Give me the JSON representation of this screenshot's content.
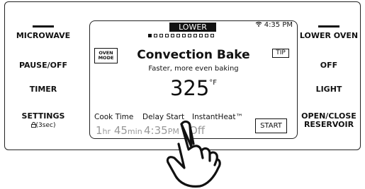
{
  "left_buttons": {
    "microwave": "MICROWAVE",
    "pause_off": "PAUSE/OFF",
    "timer": "TIMER",
    "settings": "SETTINGS",
    "settings_sub": "­(3sec)"
  },
  "right_buttons": {
    "lower_oven": "LOWER OVEN",
    "off": "OFF",
    "light": "LIGHT",
    "open_close_reservoir_line1": "OPEN/CLOSE",
    "open_close_reservoir_line2": "RESERVOIR"
  },
  "screen": {
    "tab_label": "LOWER",
    "clock": "4:35 PM",
    "page_dots": {
      "total": 12,
      "active": 1
    },
    "oven_mode_line1": "OVEN",
    "oven_mode_line2": "MODE",
    "tip_label": "TIP",
    "mode_title": "Convection Bake",
    "mode_subtitle": "Faster, more even baking",
    "temperature": "325",
    "temperature_unit": "°F",
    "cook_time_label": "Cook Time",
    "cook_time_hr": "1",
    "cook_time_hr_unit": "hr",
    "cook_time_min": "45",
    "cook_time_min_unit": "min",
    "delay_start_label": "Delay Start",
    "delay_start_time": "4:35",
    "delay_start_ampm": "PM",
    "instantheat_label": "InstantHeat™",
    "instantheat_value": "Off",
    "start_label": "START"
  },
  "icons": {
    "wifi": "wifi-icon",
    "lock": "lock-icon",
    "hand": "hand-pointer-icon"
  }
}
